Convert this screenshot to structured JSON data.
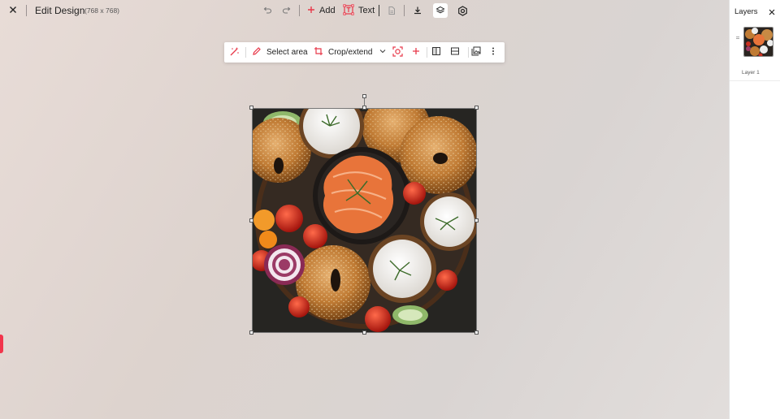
{
  "topbar": {
    "title": "Edit Design",
    "dimensions": "(768 x 768)",
    "add_label": "Add",
    "text_label": "Text",
    "icons": [
      "close-icon",
      "undo-icon",
      "redo-icon",
      "plus-icon",
      "text-frame-icon",
      "document-icon",
      "download-icon",
      "layers-icon",
      "settings-icon"
    ]
  },
  "float_toolbar": {
    "select_area_label": "Select area",
    "crop_label": "Crop/extend",
    "icons": [
      "magic-wand-icon",
      "pencil-icon",
      "crop-icon",
      "chevron-down-icon",
      "focus-target-icon",
      "plus-icon",
      "flip-horizontal-icon",
      "flip-vertical-icon",
      "image-layers-icon",
      "more-vertical-icon"
    ]
  },
  "layers_panel": {
    "title": "Layers",
    "layers": [
      {
        "label": "Layer 1"
      }
    ]
  },
  "colors": {
    "accent": "#e8394a",
    "panel_bg": "#ffffff",
    "canvas_bg": "#ddd3ce"
  }
}
